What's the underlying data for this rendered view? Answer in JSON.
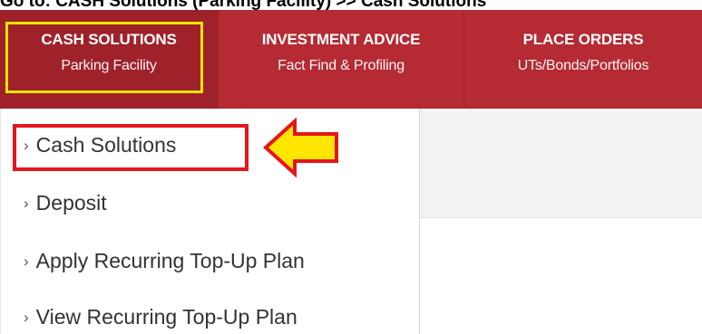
{
  "instruction": "Go to: CASH Solutions (Parking Facility) >> Cash Solutions",
  "nav": [
    {
      "title": "CASH SOLUTIONS",
      "subtitle": "Parking Facility"
    },
    {
      "title": "INVESTMENT ADVICE",
      "subtitle": "Fact Find & Profiling"
    },
    {
      "title": "PLACE ORDERS",
      "subtitle": "UTs/Bonds/Portfolios"
    }
  ],
  "menu": [
    {
      "label": "Cash Solutions"
    },
    {
      "label": "Deposit"
    },
    {
      "label": "Apply Recurring Top-Up Plan"
    },
    {
      "label": "View Recurring Top-Up Plan"
    }
  ],
  "chevron": "›",
  "colors": {
    "navbar": "#b52a33",
    "active_nav": "#9f2129",
    "nav_highlight": "#ffe600",
    "callout_box": "#e6141c",
    "arrow_fill": "#ffe600",
    "arrow_stroke": "#e6141c"
  },
  "icons": {
    "callout_arrow": "left-arrow-icon",
    "chevron": "chevron-right-icon"
  }
}
